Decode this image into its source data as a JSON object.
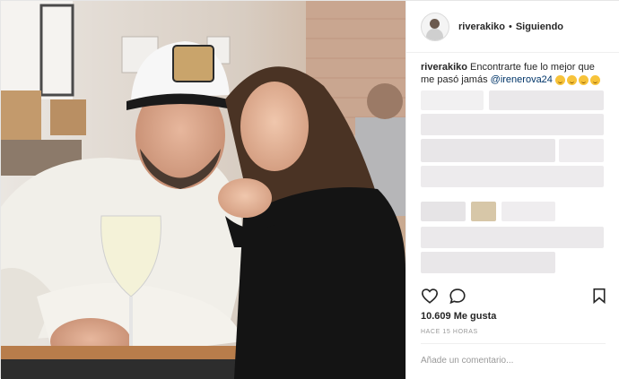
{
  "header": {
    "username": "riverakiko",
    "separator": "•",
    "follow_status": "Siguiendo"
  },
  "caption": {
    "username": "riverakiko",
    "text": "Encontrarte fue lo mejor que me pasó jamás",
    "mention": "@irenerova24",
    "emojis": [
      "smiling-face-icon",
      "smiling-face-icon",
      "smiling-face-icon",
      "smiling-face-icon"
    ]
  },
  "actions": {
    "like_icon": "heart-icon",
    "comment_icon": "comment-icon",
    "save_icon": "bookmark-icon"
  },
  "likes": "10.609 Me gusta",
  "timestamp": "HACE 15 HORAS",
  "comment_placeholder": "Añade un comentario..."
}
